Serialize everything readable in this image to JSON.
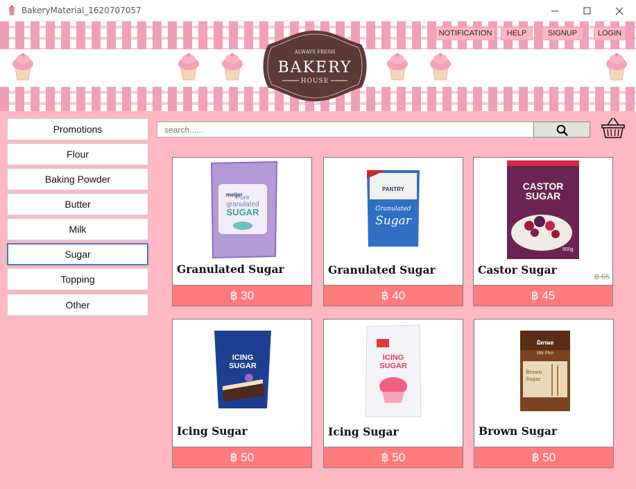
{
  "window": {
    "title": "BakeryMaterial_1620707057"
  },
  "header": {
    "nav": [
      "NOTIFICATION",
      "HELP",
      "SIGNUP",
      "LOGIN"
    ],
    "logo": {
      "tagline": "ALWAYS FRESH",
      "name": "BAKERY",
      "sub": "HOUSE"
    }
  },
  "sidebar": {
    "categories": [
      "Promotions",
      "Flour",
      "Baking Powder",
      "Butter",
      "Milk",
      "Sugar",
      "Topping",
      "Other"
    ],
    "active": "Sugar"
  },
  "search": {
    "placeholder": "search......",
    "icon": "magnifier-icon"
  },
  "cart": {
    "icon": "basket-icon"
  },
  "products": [
    {
      "name": "Granulated Sugar",
      "price": "฿ 30",
      "old_price": "",
      "package_text": [
        "meijer",
        "Pure",
        "granulated",
        "SUGAR"
      ],
      "color": "#a07fc9"
    },
    {
      "name": "Granulated Sugar",
      "price": "฿ 40",
      "old_price": "",
      "package_text": [
        "PANTRY",
        "Granulated",
        "Sugar"
      ],
      "color": "#2f6fc4"
    },
    {
      "name": "Castor Sugar",
      "price": "฿ 45",
      "old_price": "฿ 65",
      "package_text": [
        "CASTOR",
        "SUGAR",
        "500g"
      ],
      "color": "#6b2452"
    },
    {
      "name": "Icing Sugar",
      "price": "฿ 50",
      "old_price": "",
      "package_text": [
        "ICING",
        "SUGAR"
      ],
      "color": "#1e3f8f"
    },
    {
      "name": "Icing Sugar",
      "price": "฿ 50",
      "old_price": "",
      "package_text": [
        "ICING",
        "SUGAR"
      ],
      "color": "#f4f4f8"
    },
    {
      "name": "Brown Sugar",
      "price": "฿ 50",
      "old_price": "",
      "package_text": [
        "มิตรผล",
        "Mitr Phol",
        "Brown",
        "Sugar"
      ],
      "color": "#7b4322"
    }
  ]
}
